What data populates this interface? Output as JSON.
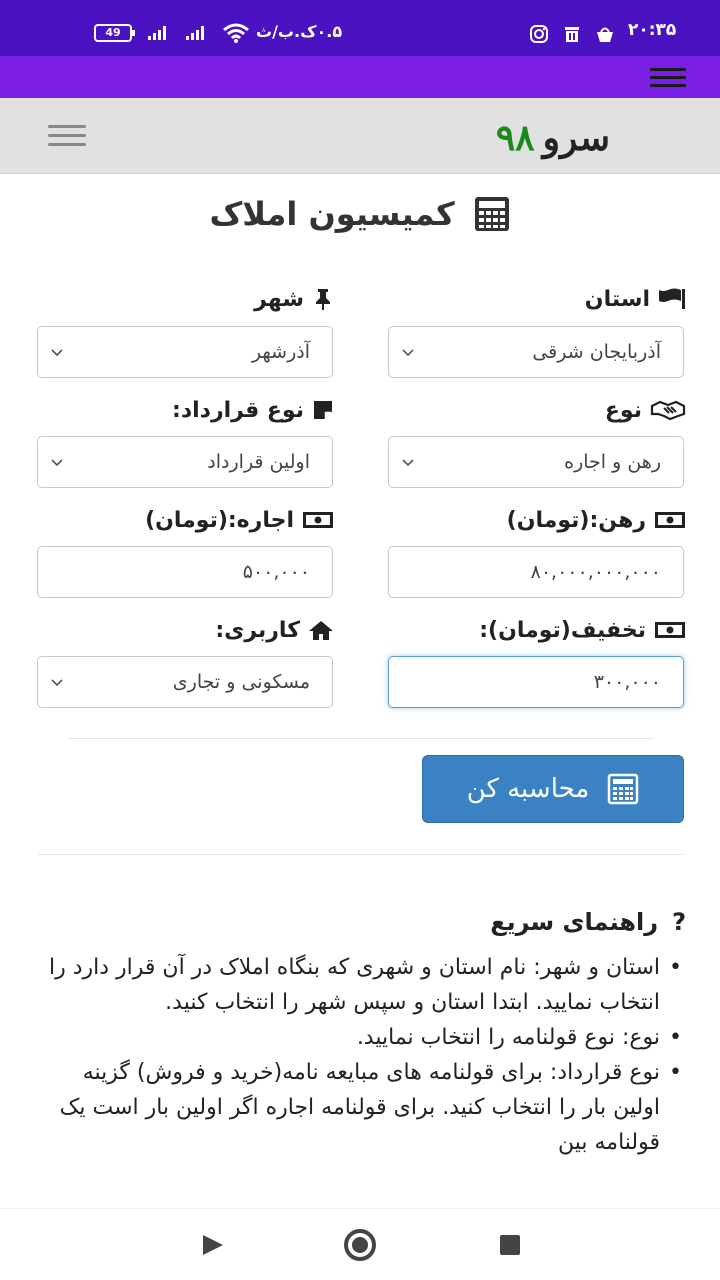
{
  "status_bar": {
    "time": "۲۰:۳۵",
    "network_speed": "۰.۵ک.ب/ث",
    "battery": "49",
    "icons": [
      "instagram-icon",
      "trash-icon",
      "basket-icon",
      "wifi-icon",
      "signal-icon",
      "battery-icon"
    ]
  },
  "header": {
    "brand_text": "سرو",
    "brand_number": "۹۸",
    "brand_number_color": "#1a8a1a"
  },
  "page": {
    "title": "کمیسیون املاک"
  },
  "form": {
    "province": {
      "label": "استان",
      "value": "آذربایجان شرقی",
      "icon": "flag-icon"
    },
    "city": {
      "label": "شهر",
      "value": "آذرشهر",
      "icon": "pin-icon"
    },
    "type": {
      "label": "نوع",
      "value": "رهن و اجاره",
      "icon": "handshake-icon"
    },
    "contract_type": {
      "label": "نوع قرارداد:",
      "value": "اولین قرارداد",
      "icon": "note-icon"
    },
    "deposit": {
      "label": "رهن:(تومان)",
      "value": "۸۰,۰۰۰,۰۰۰,۰۰۰",
      "icon": "money-icon"
    },
    "rent": {
      "label": "اجاره:(تومان)",
      "value": "۵۰۰,۰۰۰",
      "icon": "money-icon"
    },
    "discount": {
      "label": "تخفیف(تومان):",
      "value": "۳۰۰,۰۰۰",
      "icon": "money-icon"
    },
    "usage": {
      "label": "کاربری:",
      "value": "مسکونی و تجاری",
      "icon": "home-icon"
    },
    "submit_label": "محاسبه کن"
  },
  "guide": {
    "title": "راهنمای سریع",
    "items": [
      "استان و شهر: نام استان و شهری که بنگاه املاک در آن قرار دارد را انتخاب نمایید. ابتدا استان و سپس شهر را انتخاب کنید.",
      "نوع: نوع قولنامه را انتخاب نمایید.",
      "نوع قرارداد: برای قولنامه های مبایعه نامه(خرید و فروش) گزینه اولین بار را انتخاب کنید. برای قولنامه اجاره اگر اولین بار است یک قولنامه بین"
    ]
  },
  "colors": {
    "status_bar": "#4a12c0",
    "app_bar": "#7c1fe6",
    "button": "#3a82c4"
  }
}
